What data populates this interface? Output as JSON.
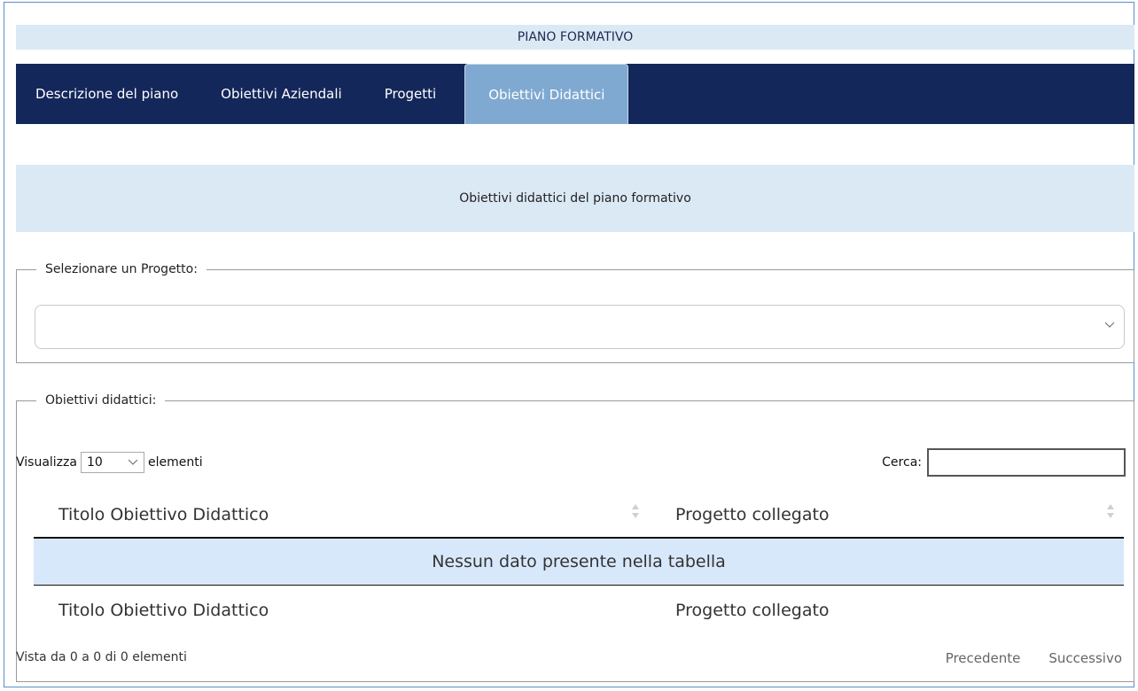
{
  "header": {
    "title": "PIANO FORMATIVO"
  },
  "tabs": [
    {
      "label": "Descrizione del piano"
    },
    {
      "label": "Obiettivi Aziendali"
    },
    {
      "label": "Progetti"
    },
    {
      "label": "Obiettivi Didattici",
      "active": true
    }
  ],
  "section": {
    "title": "Obiettivi didattici del piano formativo"
  },
  "project_select": {
    "legend": "Selezionare un Progetto:",
    "value": ""
  },
  "goals": {
    "legend": "Obiettivi didattici:",
    "show_prefix": "Visualizza",
    "page_length": "10",
    "show_suffix": "elementi",
    "search_label": "Cerca:",
    "search_value": "",
    "columns": [
      "Titolo Obiettivo Didattico",
      "Progetto collegato"
    ],
    "empty_message": "Nessun dato presente nella tabella",
    "info": "Vista da 0 a 0 di 0 elementi",
    "prev_label": "Precedente",
    "next_label": "Successivo"
  },
  "colors": {
    "nav_bg": "#14275a",
    "active_tab": "#7fa9d0",
    "light_panel": "#dbe9f5",
    "empty_row": "#d8e8fb"
  },
  "icons": {
    "dropdown": "chevron-down-icon",
    "sort": "sort-both-icon"
  }
}
